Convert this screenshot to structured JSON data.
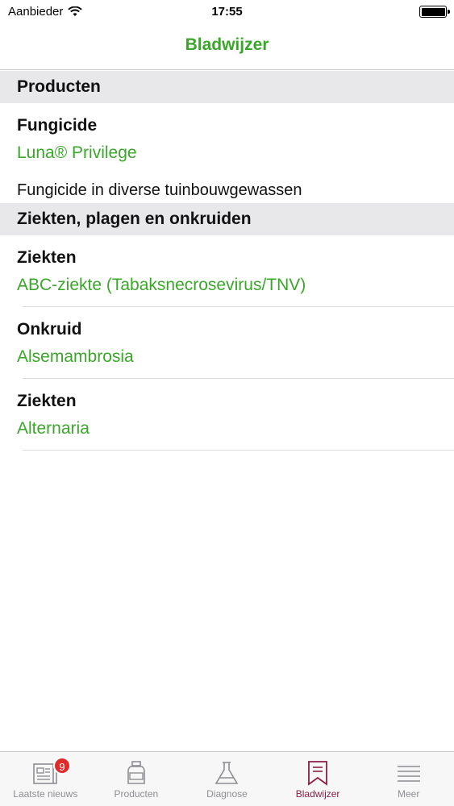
{
  "status_bar": {
    "carrier": "Aanbieder",
    "time": "17:55"
  },
  "nav": {
    "title": "Bladwijzer"
  },
  "sections": {
    "products": {
      "header": "Producten",
      "item": {
        "category": "Fungicide",
        "name": "Luna® Privilege",
        "description": "Fungicide in diverse tuinbouwgewassen"
      }
    },
    "diseases": {
      "header": "Ziekten, plagen en onkruiden",
      "items": [
        {
          "category": "Ziekten",
          "name": "ABC-ziekte (Tabaksnecrosevirus/TNV)"
        },
        {
          "category": "Onkruid",
          "name": "Alsemambrosia"
        },
        {
          "category": "Ziekten",
          "name": "Alternaria"
        }
      ]
    }
  },
  "tab_bar": {
    "tabs": [
      {
        "label": "Laatste nieuws",
        "icon": "newspaper-icon",
        "badge": "9"
      },
      {
        "label": "Producten",
        "icon": "bottle-icon"
      },
      {
        "label": "Diagnose",
        "icon": "flask-icon"
      },
      {
        "label": "Bladwijzer",
        "icon": "bookmark-icon",
        "active": true
      },
      {
        "label": "Meer",
        "icon": "menu-icon"
      }
    ]
  },
  "colors": {
    "accent_green": "#3aa62a",
    "active_tab": "#8b1e47",
    "badge": "#e02b2b"
  }
}
